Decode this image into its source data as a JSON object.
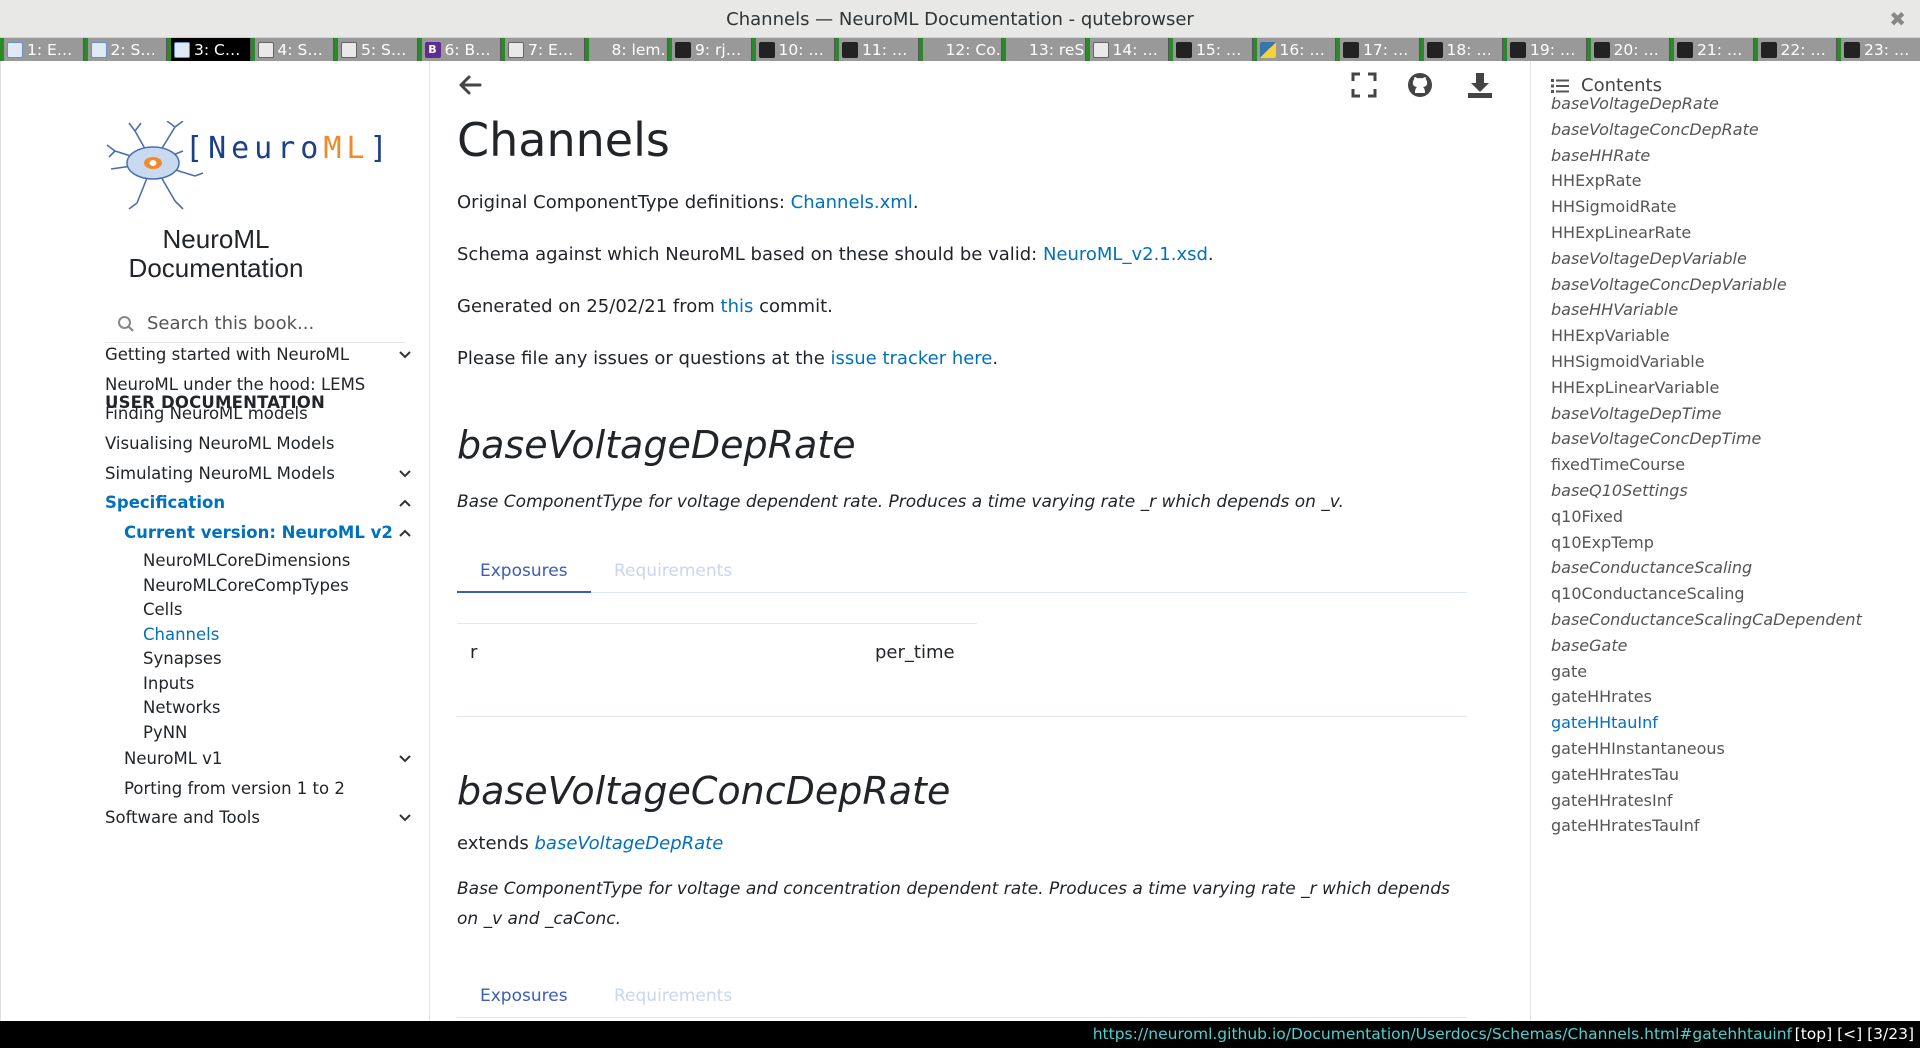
{
  "window": {
    "title": "Channels — NeuroML Documentation - qutebrowser",
    "close_glyph": "✖"
  },
  "tabs": [
    {
      "label": "1: E…",
      "icon": "neuroml-favicon",
      "selected": false
    },
    {
      "label": "2: S…",
      "icon": "neuroml-favicon",
      "selected": false
    },
    {
      "label": "3: C…",
      "icon": "neuroml-favicon",
      "selected": true
    },
    {
      "label": "4: S…",
      "icon": "site-favicon",
      "selected": false
    },
    {
      "label": "5: S…",
      "icon": "doc-favicon",
      "selected": false
    },
    {
      "label": "6: B…",
      "icon": "bootstrap-favicon",
      "selected": false
    },
    {
      "label": "7: E…",
      "icon": "doc-favicon",
      "selected": false
    },
    {
      "label": "8: lem…",
      "icon": "",
      "selected": false
    },
    {
      "label": "9: rj…",
      "icon": "github-favicon",
      "selected": false
    },
    {
      "label": "10: …",
      "icon": "github-favicon",
      "selected": false
    },
    {
      "label": "11: …",
      "icon": "github-favicon",
      "selected": false
    },
    {
      "label": "12: Co…",
      "icon": "",
      "selected": false
    },
    {
      "label": "13: reS…",
      "icon": "",
      "selected": false
    },
    {
      "label": "14: …",
      "icon": "doc-favicon",
      "selected": false
    },
    {
      "label": "15: …",
      "icon": "github-favicon",
      "selected": false
    },
    {
      "label": "16: …",
      "icon": "python-favicon",
      "selected": false
    },
    {
      "label": "17: …",
      "icon": "github-favicon",
      "selected": false
    },
    {
      "label": "18: …",
      "icon": "github-favicon",
      "selected": false
    },
    {
      "label": "19: …",
      "icon": "github-favicon",
      "selected": false
    },
    {
      "label": "20: …",
      "icon": "github-favicon",
      "selected": false
    },
    {
      "label": "21: …",
      "icon": "github-favicon",
      "selected": false
    },
    {
      "label": "22: …",
      "icon": "github-favicon",
      "selected": false
    },
    {
      "label": "23: …",
      "icon": "github-favicon",
      "selected": false
    }
  ],
  "sidebar": {
    "logo_text": "[NeuroML]",
    "logo_text_main": "Neuro",
    "logo_text_accent": "ML",
    "title_line1": "NeuroML",
    "title_line2": "Documentation",
    "search_placeholder": "Search this book...",
    "caption": "USER DOCUMENTATION",
    "items": [
      {
        "label": "Getting started with NeuroML",
        "expander": "down"
      },
      {
        "label": "NeuroML under the hood: LEMS",
        "expander": ""
      },
      {
        "label": "Finding NeuroML models",
        "expander": ""
      },
      {
        "label": "Visualising NeuroML Models",
        "expander": ""
      },
      {
        "label": "Simulating NeuroML Models",
        "expander": "down"
      },
      {
        "label": "Specification",
        "expander": "up",
        "active": true
      },
      {
        "label": "Current version: NeuroML v2",
        "expander": "up",
        "active": true
      },
      {
        "label": "NeuroMLCoreDimensions"
      },
      {
        "label": "NeuroMLCoreCompTypes"
      },
      {
        "label": "Cells"
      },
      {
        "label": "Channels",
        "active": true
      },
      {
        "label": "Synapses"
      },
      {
        "label": "Inputs"
      },
      {
        "label": "Networks"
      },
      {
        "label": "PyNN"
      },
      {
        "label": "NeuroML v1",
        "expander": "down"
      },
      {
        "label": "Porting from version 1 to 2"
      },
      {
        "label": "Software and Tools",
        "expander": "down"
      }
    ]
  },
  "main": {
    "title": "Channels",
    "p1_prefix": "Original ComponentType definitions: ",
    "p1_link": "Channels.xml",
    "p1_suffix": ".",
    "p2_prefix": "Schema against which NeuroML based on these should be valid: ",
    "p2_link": "NeuroML_v2.1.xsd",
    "p2_suffix": ".",
    "p3_prefix": "Generated on 25/02/21 from ",
    "p3_link": "this",
    "p3_suffix": " commit.",
    "p4_prefix": "Please file any issues or questions at the ",
    "p4_link": "issue tracker here",
    "p4_suffix": ".",
    "sections": [
      {
        "heading": "baseVoltageDepRate",
        "description": "Base ComponentType for voltage dependent rate. Produces a time varying rate _r which depends on _v.",
        "tab_exposures": "Exposures",
        "tab_requirements": "Requirements",
        "rows": [
          {
            "name": "r",
            "dimension": "per_time"
          }
        ]
      },
      {
        "heading": "baseVoltageConcDepRate",
        "extends_prefix": "extends ",
        "extends_link": "baseVoltageDepRate",
        "description": "Base ComponentType for voltage and concentration dependent rate. Produces a time varying rate _r which depends on _v and _caConc.",
        "tab_exposures": "Exposures",
        "tab_requirements": "Requirements"
      }
    ]
  },
  "toc": {
    "title": "Contents",
    "items": [
      {
        "label": "baseVoltageDepRate",
        "italic": true
      },
      {
        "label": "baseVoltageConcDepRate",
        "italic": true
      },
      {
        "label": "baseHHRate",
        "italic": true
      },
      {
        "label": "HHExpRate"
      },
      {
        "label": "HHSigmoidRate"
      },
      {
        "label": "HHExpLinearRate"
      },
      {
        "label": "baseVoltageDepVariable",
        "italic": true
      },
      {
        "label": "baseVoltageConcDepVariable",
        "italic": true
      },
      {
        "label": "baseHHVariable",
        "italic": true
      },
      {
        "label": "HHExpVariable"
      },
      {
        "label": "HHSigmoidVariable"
      },
      {
        "label": "HHExpLinearVariable"
      },
      {
        "label": "baseVoltageDepTime",
        "italic": true
      },
      {
        "label": "baseVoltageConcDepTime",
        "italic": true
      },
      {
        "label": "fixedTimeCourse"
      },
      {
        "label": "baseQ10Settings",
        "italic": true
      },
      {
        "label": "q10Fixed"
      },
      {
        "label": "q10ExpTemp"
      },
      {
        "label": "baseConductanceScaling",
        "italic": true
      },
      {
        "label": "q10ConductanceScaling"
      },
      {
        "label": "baseConductanceScalingCaDependent",
        "italic": true
      },
      {
        "label": "baseGate",
        "italic": true
      },
      {
        "label": "gate"
      },
      {
        "label": "gateHHrates"
      },
      {
        "label": "gateHHtauInf",
        "active": true
      },
      {
        "label": "gateHHInstantaneous"
      },
      {
        "label": "gateHHratesTau"
      },
      {
        "label": "gateHHratesInf"
      },
      {
        "label": "gateHHratesTauInf"
      }
    ]
  },
  "statusbar": {
    "url": "https://neuroml.github.io/Documentation/Userdocs/Schemas/Channels.html#gatehhtauinf",
    "position": "[top] [<] [3/23]"
  },
  "colors": {
    "link": "#0071bc",
    "tab_accent": "#3a5bbf",
    "url_text": "#4fd0d0"
  }
}
